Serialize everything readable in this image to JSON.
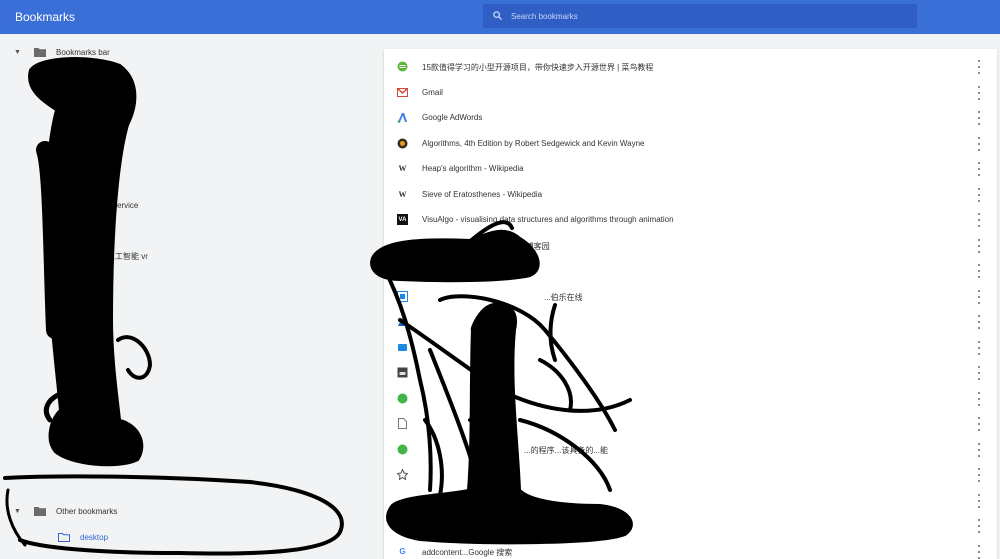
{
  "app": {
    "title": "Bookmarks"
  },
  "search": {
    "placeholder": "Search bookmarks",
    "icon": "search-icon"
  },
  "sidebar": {
    "items": [
      {
        "label": "Bookmarks bar",
        "expanded": true
      },
      {
        "label": "service"
      },
      {
        "label": "人工智能 vr"
      },
      {
        "label": "Other bookmarks",
        "expanded": true
      },
      {
        "label": "desktop",
        "selected": true
      }
    ]
  },
  "bookmarks": [
    {
      "title": "15款值得学习的小型开源项目，带你快速步入开源世界 | 菜鸟教程",
      "icon": "runoob-icon"
    },
    {
      "title": "Gmail",
      "icon": "gmail-icon"
    },
    {
      "title": "Google AdWords",
      "icon": "adwords-icon"
    },
    {
      "title": "Algorithms, 4th Edition by Robert Sedgewick and Kevin Wayne",
      "icon": "algs4-icon"
    },
    {
      "title": "Heap's algorithm - Wikipedia",
      "icon": "wikipedia-icon"
    },
    {
      "title": "Sieve of Eratosthenes - Wikipedia",
      "icon": "wikipedia-icon"
    },
    {
      "title": "VisuAlgo - visualising data structures and algorithms through animation",
      "icon": "visualgo-icon"
    },
    {
      "title": "...数引发的血...识库_博客园",
      "icon": "page-icon"
    },
    {
      "title": "",
      "icon": "page-icon"
    },
    {
      "title": "...伯乐在线",
      "icon": "jobbole-icon"
    },
    {
      "title": "",
      "icon": "page-icon"
    },
    {
      "title": "",
      "icon": "page-icon"
    },
    {
      "title": "",
      "icon": "page-icon"
    },
    {
      "title": "",
      "icon": "wechat-icon"
    },
    {
      "title": "",
      "icon": "page-icon"
    },
    {
      "title": "...的程序...该具备的...能",
      "icon": "wechat-icon"
    },
    {
      "title": "",
      "icon": "page-icon"
    },
    {
      "title": "",
      "icon": "page-icon"
    },
    {
      "title": "",
      "icon": "page-icon"
    },
    {
      "title": "addcontent...Google 搜索",
      "icon": "google-icon"
    }
  ],
  "colors": {
    "header": "#3b6fd8",
    "accent": "#3367d6"
  }
}
